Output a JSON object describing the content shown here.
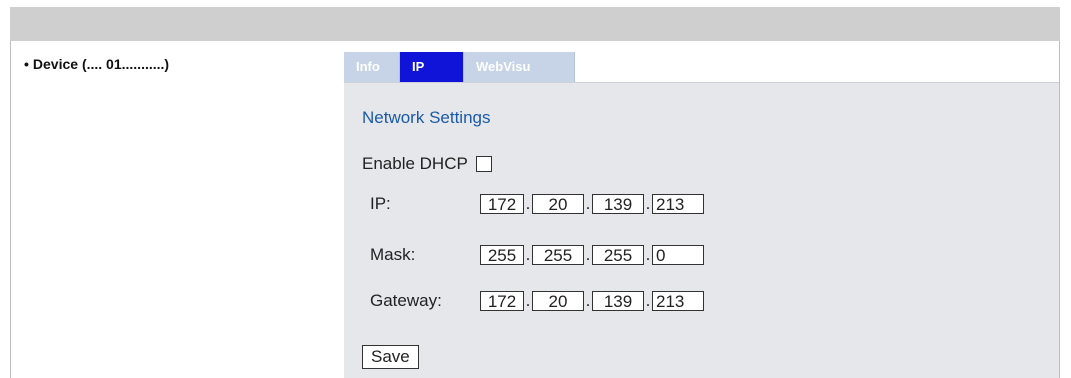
{
  "tree": {
    "item": "Device (.... 01...........)"
  },
  "tabs": [
    {
      "label": "Info",
      "active": false
    },
    {
      "label": "IP",
      "active": true
    },
    {
      "label": "WebVisu",
      "active": false
    }
  ],
  "network": {
    "title": "Network Settings",
    "dhcp_label": "Enable DHCP",
    "dhcp_checked": false,
    "ip": {
      "label": "IP:",
      "octets": [
        "172",
        "20",
        "139",
        "213"
      ]
    },
    "mask": {
      "label": "Mask:",
      "octets": [
        "255",
        "255",
        "255",
        "0"
      ]
    },
    "gateway": {
      "label": "Gateway:",
      "octets": [
        "172",
        "20",
        "139",
        "213"
      ]
    },
    "save_label": "Save"
  },
  "colors": {
    "active_tab": "#0f14d8",
    "inactive_tab": "#c7d3e6",
    "title": "#1b5aa7",
    "panel": "#e5e7ea"
  }
}
